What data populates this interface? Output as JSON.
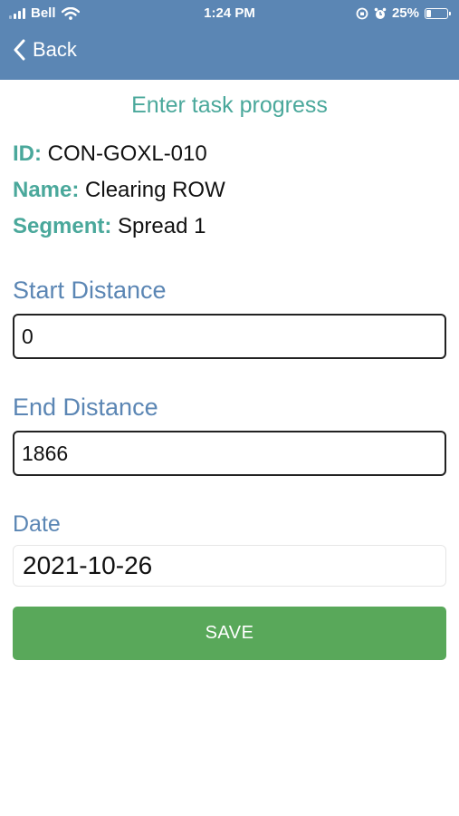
{
  "status_bar": {
    "carrier": "Bell",
    "time": "1:24 PM",
    "battery_percent": "25%",
    "battery_level": 0.25,
    "icons": [
      "signal-icon",
      "wifi-icon",
      "orientation-lock-icon",
      "alarm-icon",
      "battery-icon"
    ]
  },
  "nav": {
    "back_label": "Back"
  },
  "title": "Enter task progress",
  "task": {
    "id_label": "ID:",
    "id_value": "CON-GOXL-010",
    "name_label": "Name:",
    "name_value": "Clearing ROW",
    "segment_label": "Segment:",
    "segment_value": "Spread 1"
  },
  "form": {
    "start_label": "Start Distance",
    "start_value": "0",
    "end_label": "End Distance",
    "end_value": "1866",
    "date_label": "Date",
    "date_value": "2021-10-26",
    "save_label": "SAVE"
  },
  "colors": {
    "header": "#5b86b4",
    "accent_teal": "#4aa89b",
    "label_blue": "#5b86b4",
    "save_green": "#59a85a"
  }
}
